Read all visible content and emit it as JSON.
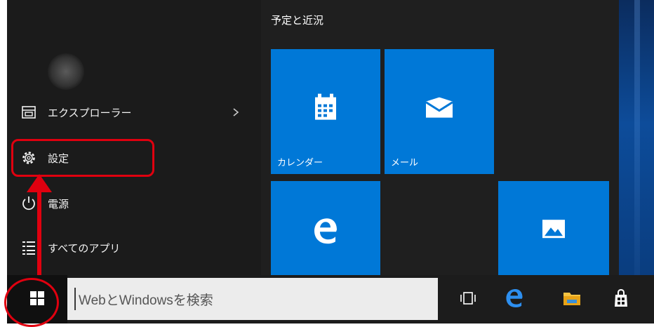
{
  "start_menu": {
    "left_items": [
      {
        "label": "エクスプローラー",
        "icon": "file-explorer-icon",
        "has_submenu": true
      },
      {
        "label": "設定",
        "icon": "gear-icon"
      },
      {
        "label": "電源",
        "icon": "power-icon"
      },
      {
        "label": "すべてのアプリ",
        "icon": "all-apps-icon"
      }
    ],
    "group_title": "予定と近況",
    "tiles": [
      {
        "label": "カレンダー",
        "icon": "calendar-icon"
      },
      {
        "label": "メール",
        "icon": "mail-icon"
      },
      {
        "label": "",
        "icon": "edge-icon"
      },
      {
        "label": "",
        "icon": "photos-icon"
      }
    ]
  },
  "taskbar": {
    "start_icon": "windows-logo-icon",
    "search_placeholder": "WebとWindowsを検索",
    "icons": [
      "task-view-icon",
      "edge-icon",
      "file-explorer-icon",
      "store-icon"
    ]
  },
  "colors": {
    "tile_blue": "#0078d7",
    "menu_bg": "#1f1f1f",
    "annotation_red": "#e0000f"
  }
}
